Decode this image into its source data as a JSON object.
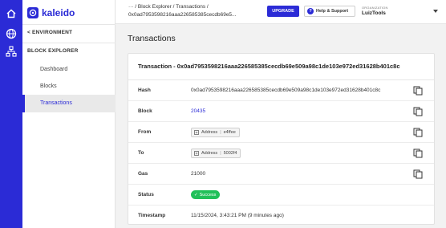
{
  "brand": {
    "name": "kaleido",
    "accent": "#2b2bd6"
  },
  "rail": {
    "icons": [
      "home-icon",
      "globe-icon",
      "network-icon"
    ]
  },
  "sidebar": {
    "back_label": "< ENVIRONMENT",
    "section_label": "BLOCK EXPLORER",
    "items": [
      {
        "label": "Dashboard",
        "active": false
      },
      {
        "label": "Blocks",
        "active": false
      },
      {
        "label": "Transactions",
        "active": true
      }
    ]
  },
  "topbar": {
    "breadcrumb_line1": "··· / Block Explorer / Transactions /",
    "breadcrumb_line2": "0x0ad7953598216aaa226585385cecdb69e5...",
    "upgrade_label": "UPGRADE",
    "help_label": "Help & Support",
    "org_label": "ORGANIZATION",
    "org_value": "LuizTools"
  },
  "page": {
    "title": "Transactions"
  },
  "transaction": {
    "title": "Transaction - 0x0ad7953598216aaa226585385cecdb69e509a98c1de103e972ed31628b401c8c",
    "rows": {
      "hash": {
        "key": "Hash",
        "value": "0x0ad7953598216aaa226585385cecdb69e509a98c1de103e972ed31628b401c8c"
      },
      "block": {
        "key": "Block",
        "value": "20435"
      },
      "from": {
        "key": "From",
        "addr_label": "Address",
        "addr_value": "e4ffee"
      },
      "to": {
        "key": "To",
        "addr_label": "Address",
        "addr_value": "5002f4"
      },
      "gas": {
        "key": "Gas",
        "value": "21000"
      },
      "status": {
        "key": "Status",
        "value": "Success"
      },
      "timestamp": {
        "key": "Timestamp",
        "value": "11/15/2024, 3:43:21 PM (9 minutes ago)"
      }
    }
  },
  "colors": {
    "success": "#22c05a",
    "rail": "#2b2bd6"
  }
}
